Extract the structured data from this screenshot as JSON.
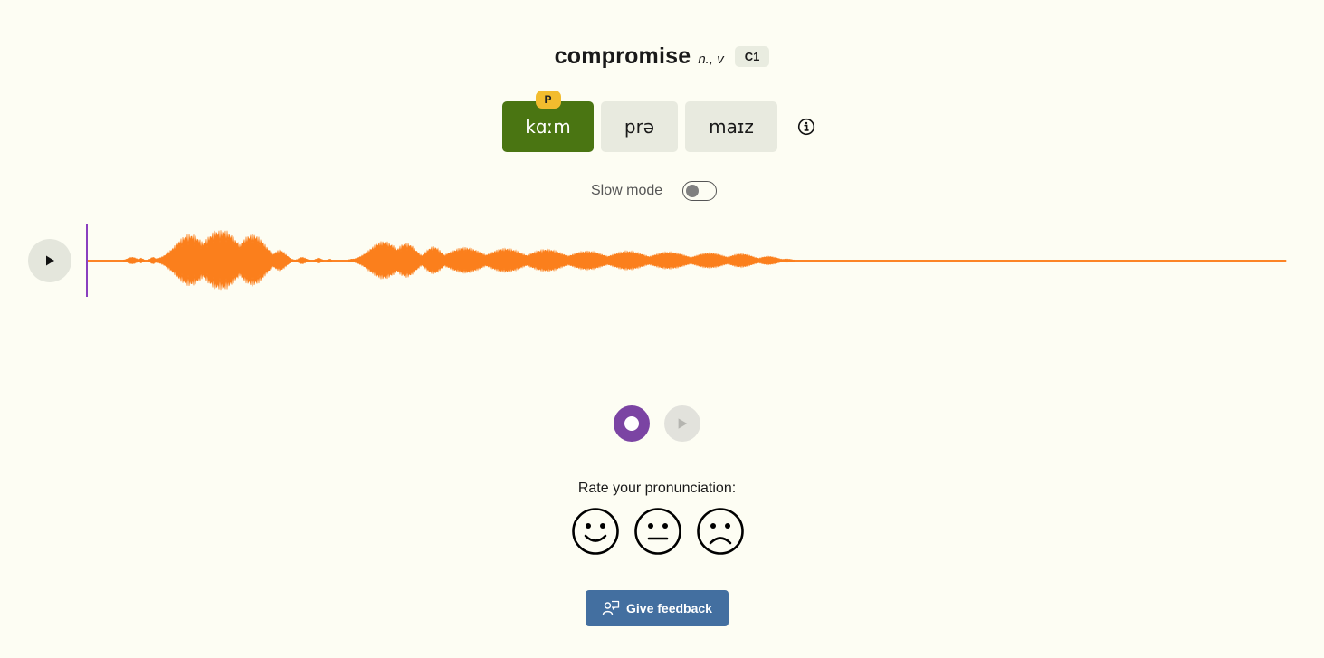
{
  "word": {
    "text": "compromise",
    "part_of_speech": "n., v",
    "level": "C1"
  },
  "syllables": [
    {
      "ipa": "kɑːm",
      "stressed": true,
      "stress_label": "P"
    },
    {
      "ipa": "prə",
      "stressed": false
    },
    {
      "ipa": "maɪz",
      "stressed": false
    }
  ],
  "slow_mode": {
    "label": "Slow mode",
    "enabled": false
  },
  "rating": {
    "prompt": "Rate your pronunciation:",
    "options": [
      "happy-face",
      "neutral-face",
      "sad-face"
    ]
  },
  "feedback": {
    "label": "Give feedback"
  },
  "colors": {
    "background": "#fdfdf3",
    "stressed_syllable": "#4a7512",
    "stress_badge": "#f2bc2e",
    "waveform": "#fb7f1c",
    "playhead": "#8a3fbf",
    "record_button": "#7b44a3",
    "feedback_button": "#436fa0"
  },
  "icons": {
    "play": "play-icon",
    "info": "info-icon",
    "record": "record-icon",
    "feedback": "feedback-icon"
  }
}
